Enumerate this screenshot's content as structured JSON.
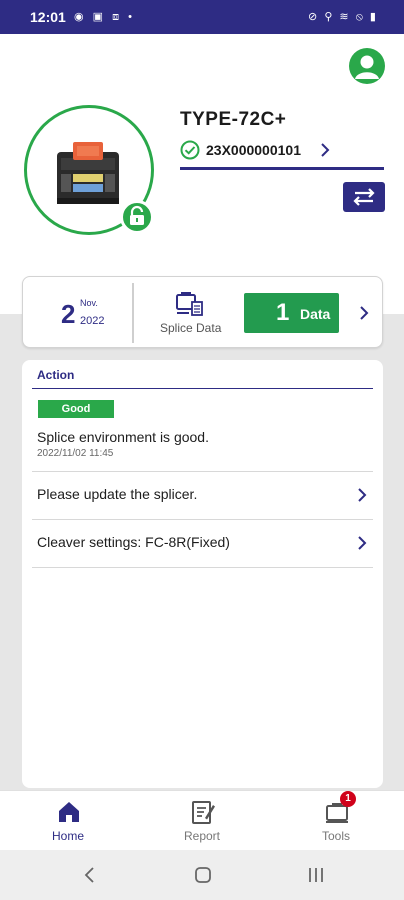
{
  "status_bar": {
    "time": "12:01",
    "left_icons": "◉ ▣ ⧈ •",
    "right_icons": "⊘ ⚲ ≋ ⦸ ▮"
  },
  "device": {
    "model": "TYPE-72C+",
    "serial": "23X000000101"
  },
  "summary": {
    "day": "2",
    "month": "Nov.",
    "year": "2022",
    "splice_label": "Splice Data",
    "data_count": "1",
    "data_label": "Data"
  },
  "action": {
    "title": "Action",
    "status_badge": "Good",
    "environment_message": "Splice environment is good.",
    "environment_timestamp": "2022/11/02 11:45",
    "items": [
      {
        "label": "Please update the splicer."
      },
      {
        "label": "Cleaver settings: FC-8R(Fixed)"
      }
    ]
  },
  "nav": {
    "home": "Home",
    "report": "Report",
    "tools": "Tools",
    "tools_badge": "1"
  },
  "colors": {
    "brand": "#2e2c84",
    "accent_green": "#2aa84a",
    "data_green": "#239b4f",
    "badge_red": "#d0021b"
  },
  "icons": {
    "account": "account-icon",
    "lock": "unlock-icon",
    "check": "check-circle-icon",
    "swap": "swap-icon",
    "splice": "splice-data-icon",
    "home": "home-icon",
    "report": "report-icon",
    "tools": "tools-icon"
  }
}
